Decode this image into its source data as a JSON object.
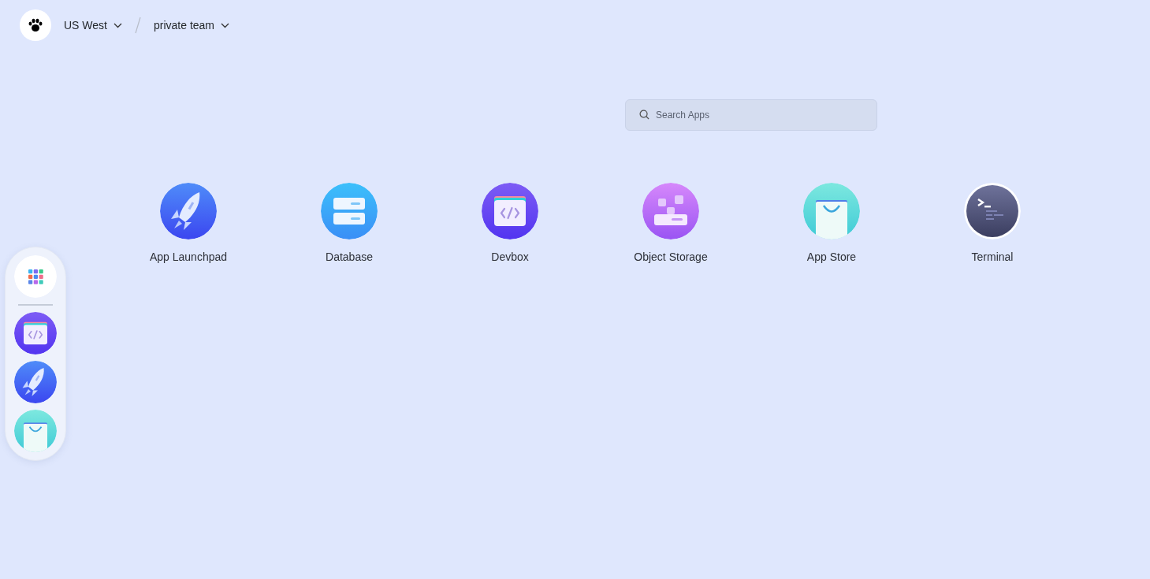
{
  "header": {
    "region": "US West",
    "team": "private team"
  },
  "search": {
    "placeholder": "Search Apps"
  },
  "apps": [
    {
      "name": "App Launchpad",
      "kind": "rocket"
    },
    {
      "name": "Database",
      "kind": "database"
    },
    {
      "name": "Devbox",
      "kind": "devbox"
    },
    {
      "name": "Object Storage",
      "kind": "storage"
    },
    {
      "name": "App Store",
      "kind": "store"
    },
    {
      "name": "Terminal",
      "kind": "terminal"
    }
  ],
  "dock": [
    {
      "kind": "grid"
    },
    {
      "kind": "devbox"
    },
    {
      "kind": "rocket"
    },
    {
      "kind": "store"
    }
  ]
}
